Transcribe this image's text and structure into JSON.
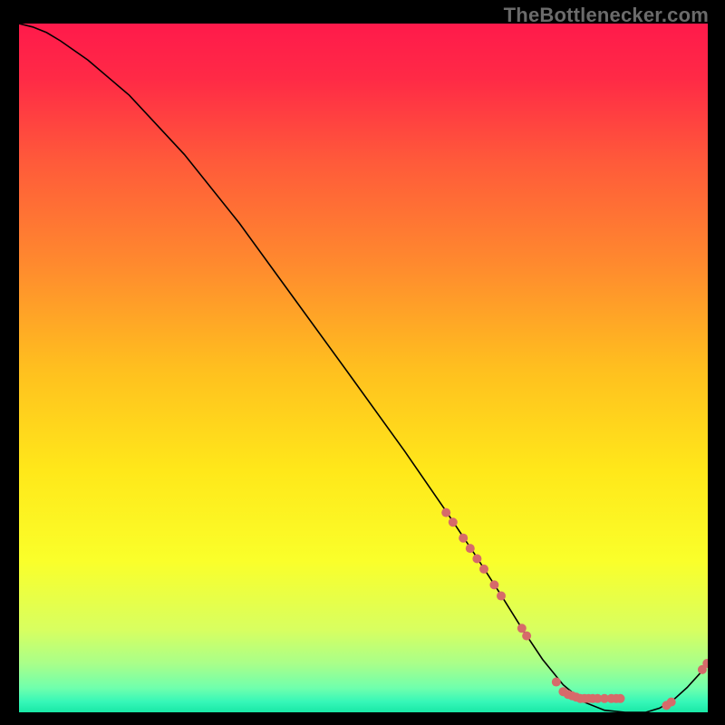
{
  "watermark": {
    "text": "TheBottlenecker.com"
  },
  "gradient": {
    "stops": [
      {
        "offset": 0.0,
        "color": "#ff1a4b"
      },
      {
        "offset": 0.08,
        "color": "#ff2a46"
      },
      {
        "offset": 0.2,
        "color": "#ff5a3a"
      },
      {
        "offset": 0.35,
        "color": "#ff8a2e"
      },
      {
        "offset": 0.5,
        "color": "#ffbf1f"
      },
      {
        "offset": 0.65,
        "color": "#ffe81a"
      },
      {
        "offset": 0.78,
        "color": "#faff2a"
      },
      {
        "offset": 0.88,
        "color": "#d8ff60"
      },
      {
        "offset": 0.93,
        "color": "#a8ff8a"
      },
      {
        "offset": 0.965,
        "color": "#6fffad"
      },
      {
        "offset": 0.985,
        "color": "#35f7b8"
      },
      {
        "offset": 1.0,
        "color": "#19e8a6"
      }
    ]
  },
  "chart_data": {
    "type": "line",
    "title": "",
    "xlabel": "",
    "ylabel": "",
    "xlim": [
      0,
      100
    ],
    "ylim": [
      0,
      100
    ],
    "series": [
      {
        "name": "bottleneck-curve",
        "x": [
          0,
          2,
          4,
          6,
          10,
          16,
          24,
          32,
          40,
          48,
          56,
          62,
          66,
          70,
          73,
          76,
          79,
          82,
          85,
          88,
          91,
          93,
          95,
          97,
          99,
          100
        ],
        "y": [
          100,
          99.5,
          98.7,
          97.5,
          94.7,
          89.6,
          81.0,
          71.0,
          60.0,
          49.0,
          37.9,
          29.2,
          23.2,
          17.0,
          12.2,
          7.7,
          4.0,
          1.5,
          0.3,
          0.0,
          0.0,
          0.6,
          1.8,
          3.6,
          5.8,
          7.0
        ]
      }
    ],
    "markers": {
      "name": "scatter-points",
      "color": "#d66a6a",
      "radius": 5,
      "points": [
        {
          "x": 62,
          "y": 29.0
        },
        {
          "x": 63,
          "y": 27.6
        },
        {
          "x": 64.5,
          "y": 25.3
        },
        {
          "x": 65.5,
          "y": 23.8
        },
        {
          "x": 66.5,
          "y": 22.3
        },
        {
          "x": 67.5,
          "y": 20.8
        },
        {
          "x": 69,
          "y": 18.5
        },
        {
          "x": 70,
          "y": 16.9
        },
        {
          "x": 73,
          "y": 12.2
        },
        {
          "x": 73.7,
          "y": 11.1
        },
        {
          "x": 78,
          "y": 4.4
        },
        {
          "x": 79,
          "y": 3.0
        },
        {
          "x": 79.7,
          "y": 2.6
        },
        {
          "x": 80.3,
          "y": 2.4
        },
        {
          "x": 80.9,
          "y": 2.2
        },
        {
          "x": 81.5,
          "y": 2.0
        },
        {
          "x": 82.1,
          "y": 2.0
        },
        {
          "x": 82.7,
          "y": 2.0
        },
        {
          "x": 83.3,
          "y": 2.0
        },
        {
          "x": 84.0,
          "y": 2.0
        },
        {
          "x": 85.0,
          "y": 2.0
        },
        {
          "x": 86.0,
          "y": 2.0
        },
        {
          "x": 86.7,
          "y": 2.0
        },
        {
          "x": 87.3,
          "y": 2.0
        },
        {
          "x": 94.0,
          "y": 1.0
        },
        {
          "x": 94.7,
          "y": 1.5
        },
        {
          "x": 99.2,
          "y": 6.2
        },
        {
          "x": 99.9,
          "y": 7.1
        }
      ]
    }
  }
}
